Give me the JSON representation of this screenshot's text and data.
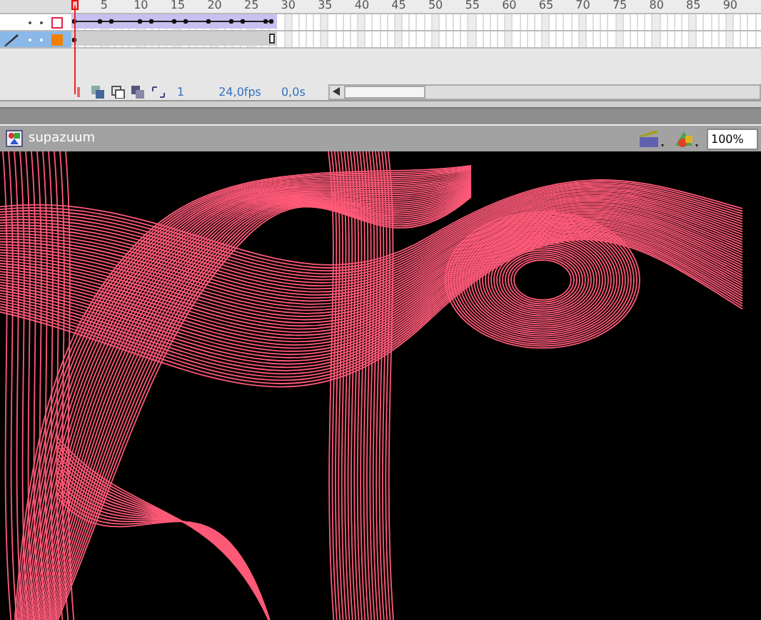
{
  "timeline": {
    "ruler_labels": [
      "5",
      "10",
      "15",
      "20",
      "25",
      "30",
      "35",
      "40",
      "45",
      "50",
      "55",
      "60",
      "65",
      "70",
      "75",
      "80",
      "85",
      "90"
    ],
    "layers": [
      {
        "selected": false,
        "outline": true,
        "color": "#e0204a",
        "kind": "tween"
      },
      {
        "selected": true,
        "outline": false,
        "color": "#f08000",
        "kind": "keyframe"
      }
    ],
    "footer": {
      "frame": "1",
      "fps": "24,0",
      "fps_unit": "fps",
      "time": "0,0",
      "time_unit": "s"
    }
  },
  "document": {
    "title": "supazuum",
    "zoom": "100%"
  }
}
